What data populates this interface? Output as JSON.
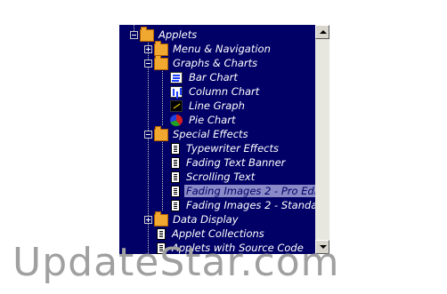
{
  "tree": {
    "items": [
      {
        "label": "Applets",
        "icon": "open-folder-icon",
        "expander": "minus",
        "level": 0
      },
      {
        "label": "Menu & Navigation",
        "icon": "folder-icon",
        "expander": "plus",
        "level": 1
      },
      {
        "label": "Graphs & Charts",
        "icon": "open-folder-icon",
        "expander": "minus",
        "level": 1
      },
      {
        "label": "Bar Chart",
        "icon": "bar-chart-icon",
        "expander": "none",
        "level": 2
      },
      {
        "label": "Column Chart",
        "icon": "column-chart-icon",
        "expander": "none",
        "level": 2
      },
      {
        "label": "Line Graph",
        "icon": "line-graph-icon",
        "expander": "none",
        "level": 2
      },
      {
        "label": "Pie Chart",
        "icon": "pie-chart-icon",
        "expander": "none",
        "level": 2
      },
      {
        "label": "Special Effects",
        "icon": "open-folder-icon",
        "expander": "minus",
        "level": 1
      },
      {
        "label": "Typewriter Effects",
        "icon": "document-icon",
        "expander": "none",
        "level": 2
      },
      {
        "label": "Fading Text Banner",
        "icon": "document-icon",
        "expander": "none",
        "level": 2
      },
      {
        "label": "Scrolling Text",
        "icon": "document-icon",
        "expander": "none",
        "level": 2
      },
      {
        "label": "Fading Images 2 - Pro Edi",
        "icon": "document-icon",
        "expander": "none",
        "level": 2,
        "selected": true
      },
      {
        "label": "Fading Images 2 - Standa",
        "icon": "document-icon",
        "expander": "none",
        "level": 2
      },
      {
        "label": "Data Display",
        "icon": "folder-icon",
        "expander": "plus",
        "level": 1
      },
      {
        "label": "Applet Collections",
        "icon": "document-icon",
        "expander": "none",
        "level": 1
      },
      {
        "label": "Applets with Source Code",
        "icon": "document-icon",
        "expander": "none",
        "level": 1
      }
    ]
  },
  "colors": {
    "tree_background": "#000066",
    "selection": "#8a8ac9",
    "text": "#ffffff"
  },
  "watermark": "UpdateStar.com"
}
